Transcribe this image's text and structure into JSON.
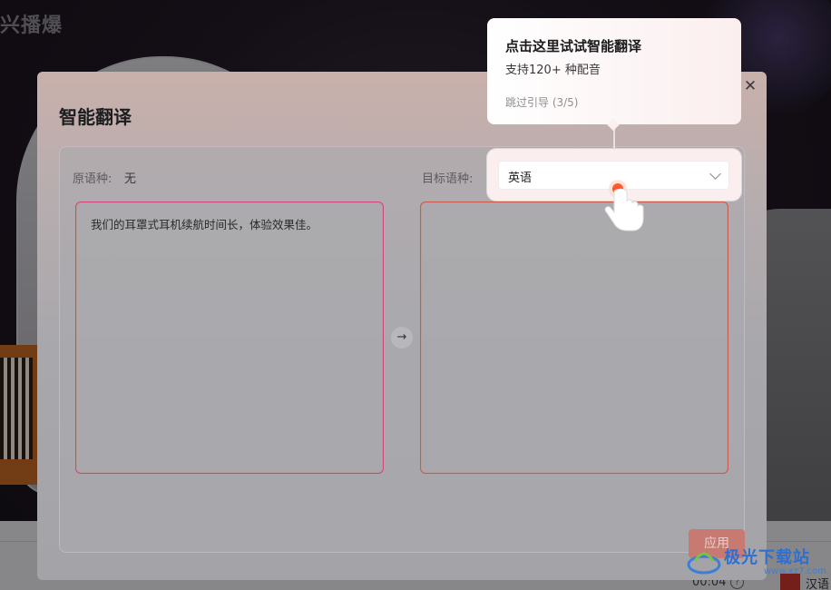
{
  "background": {
    "title": "兴播爆",
    "time": "00:04",
    "language": "汉语"
  },
  "dialog": {
    "title": "智能翻译",
    "source_label": "原语种:",
    "source_value": "无",
    "target_label": "目标语种:",
    "target_value": "英语",
    "source_text": "我们的耳罩式耳机续航时间长，体验效果佳。",
    "target_text": "",
    "apply_label": "应用"
  },
  "guide": {
    "title": "点击这里试试智能翻译",
    "subtitle": "支持120+ 种配音",
    "skip_label": "跳过引导 (3/5)"
  },
  "watermark": {
    "text": "极光下载站",
    "sub": "www.xz7.com"
  },
  "colors": {
    "accent": "#e8573a",
    "border_gradient_start": "#d0467f",
    "border_gradient_end": "#e08a3b"
  }
}
